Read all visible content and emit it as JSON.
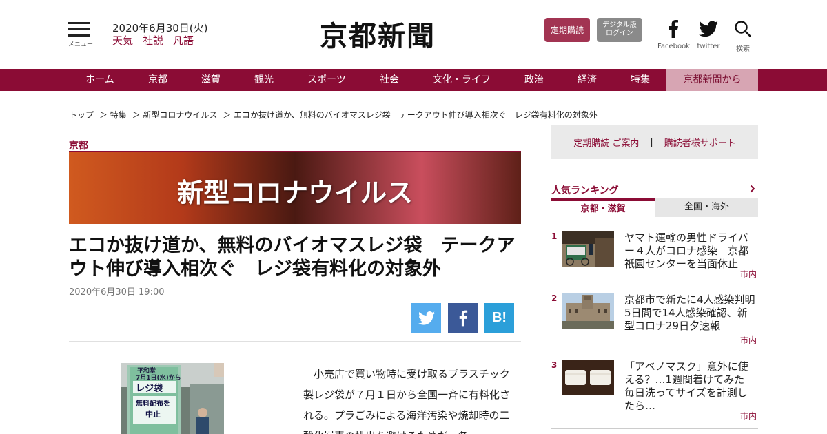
{
  "header": {
    "menu_label": "メニュー",
    "date": "2020年6月30日(火)",
    "links": [
      "天気",
      "社説",
      "凡語"
    ],
    "logo": "京都新聞",
    "subscribe_label": "定期購読",
    "digital_login_line1": "デジタル版",
    "digital_login_line2": "ログイン",
    "facebook_label": "Facebook",
    "twitter_label": "twitter",
    "search_label": "検索"
  },
  "nav": {
    "items": [
      "ホーム",
      "京都",
      "滋賀",
      "観光",
      "スポーツ",
      "社会",
      "文化・ライフ",
      "政治",
      "経済",
      "特集",
      "京都新聞から"
    ]
  },
  "breadcrumb": [
    "トップ",
    "＞ 特集",
    "＞ 新型コロナウイルス",
    "＞ エコか抜け道か、無料のバイオマスレジ袋　テークアウト伸び導入相次ぐ　レジ袋有料化の対象外"
  ],
  "article": {
    "region": "京都",
    "banner_text": "新型コロナウイルス",
    "headline": "エコか抜け道か、無料のバイオマスレジ袋　テークアウト伸び導入相次ぐ　レジ袋有料化の対象外",
    "date": "2020年6月30日 19:00",
    "photo_sign_date": "7月1日(水)から",
    "photo_sign_main": "レジ袋",
    "photo_sign_sub1": "無料配布を",
    "photo_sign_sub2": "中止",
    "body": "小売店で買い物時に受け取るプラスチック製レジ袋が７月１日から全国一斉に有料化される。プラごみによる海洋汚染や焼却時の二酸化炭素の排出を避けるためだ。各"
  },
  "share": {
    "hatena_label": "B!"
  },
  "sidebar": {
    "support_subscribe": "定期購読 ご案内",
    "support_sep": "|",
    "support_help": "購読者様サポート",
    "ranking_title": "人気ランキング",
    "tab_local": "京都・滋賀",
    "tab_national": "全国・海外",
    "ranking": [
      {
        "num": "1",
        "title": "ヤマト運輸の男性ドライバー４人がコロナ感染　京都祇園センターを当面休止",
        "tag": "市内"
      },
      {
        "num": "2",
        "title": "京都市で新たに4人感染判明　5日間で14人感染確認、新型コロナ29日夕速報",
        "tag": "市内"
      },
      {
        "num": "3",
        "title": "「アベノマスク」意外に使える？…1週間着けてみた　毎日洗ってサイズを計測したら…",
        "tag": "市内"
      }
    ]
  },
  "colors": {
    "brand": "#8b0c35",
    "twitter": "#55acee",
    "facebook": "#3b5998",
    "hatena": "#2b9fd9"
  }
}
